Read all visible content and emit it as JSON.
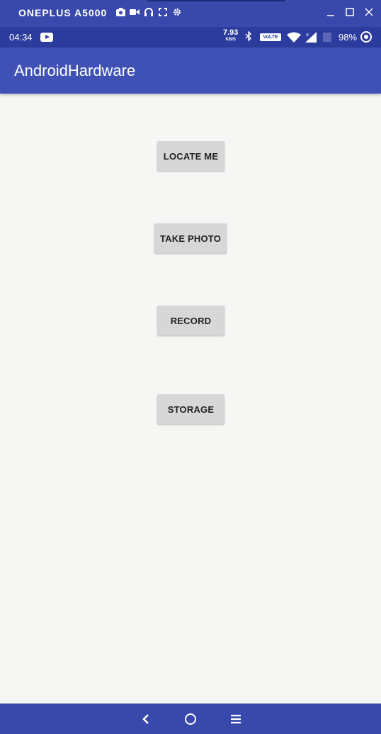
{
  "window": {
    "device_name": "ONEPLUS A5000",
    "tool_icons": [
      "camera-icon",
      "video-icon",
      "headphones-icon",
      "fullscreen-icon",
      "gear-icon"
    ],
    "controls": [
      "minimize-icon",
      "maximize-icon",
      "close-icon"
    ]
  },
  "status_bar": {
    "time": "04:34",
    "speed_value": "7.93",
    "speed_unit": "KB/S",
    "volte": "VoLTE",
    "battery": "98%"
  },
  "app_bar": {
    "title": "AndroidHardware"
  },
  "buttons": {
    "locate": "LOCATE ME",
    "photo": "TAKE PHOTO",
    "record": "RECORD",
    "storage": "STORAGE"
  },
  "colors": {
    "primary": "#3f51b5",
    "primary_dark": "#2c3c9e",
    "nav_bar": "#3949ab",
    "background": "#f6f7f5",
    "button": "#d6d7d6"
  }
}
